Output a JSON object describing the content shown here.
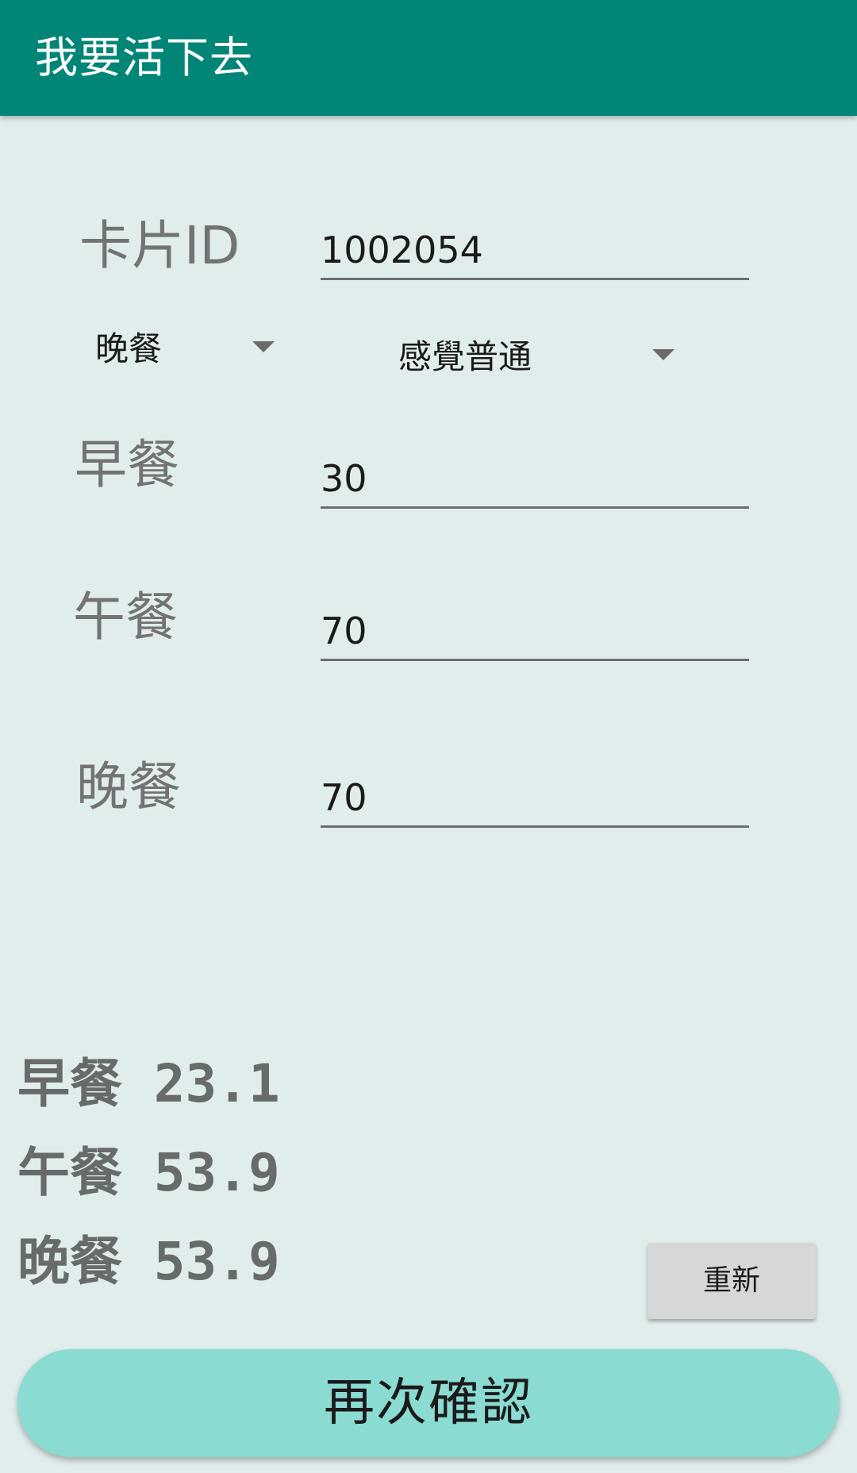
{
  "app_bar": {
    "title": "我要活下去",
    "color": "#008577"
  },
  "form": {
    "card_id": {
      "label": "卡片ID",
      "value": "1002054"
    },
    "meal_spinner": {
      "selected": "晚餐"
    },
    "feeling_spinner": {
      "selected": "感覺普通"
    },
    "breakfast": {
      "label": "早餐",
      "value": "30"
    },
    "lunch": {
      "label": "午餐",
      "value": "70"
    },
    "dinner": {
      "label": "晚餐",
      "value": "70"
    }
  },
  "results": [
    {
      "label": "早餐",
      "value": "23.1"
    },
    {
      "label": "午餐",
      "value": "53.9"
    },
    {
      "label": "晚餐",
      "value": "53.9"
    }
  ],
  "buttons": {
    "reset_label": "重新",
    "confirm_label": "再次確認",
    "confirm_color": "#8adbd1"
  }
}
